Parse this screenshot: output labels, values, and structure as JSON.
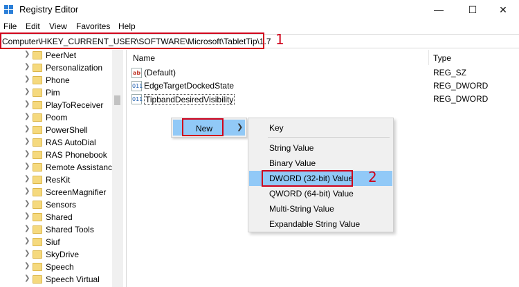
{
  "window": {
    "title": "Registry Editor",
    "controls": [
      "—",
      "☐",
      "✕"
    ]
  },
  "menubar": [
    "File",
    "Edit",
    "View",
    "Favorites",
    "Help"
  ],
  "address": {
    "path": "Computer\\HKEY_CURRENT_USER\\SOFTWARE\\Microsoft\\TabletTip\\1.7",
    "step": "1"
  },
  "tree": {
    "items": [
      "PeerNet",
      "Personalization",
      "Phone",
      "Pim",
      "PlayToReceiver",
      "Poom",
      "PowerShell",
      "RAS AutoDial",
      "RAS Phonebook",
      "Remote Assistance",
      "ResKit",
      "ScreenMagnifier",
      "Sensors",
      "Shared",
      "Shared Tools",
      "Siuf",
      "SkyDrive",
      "Speech",
      "Speech Virtual"
    ]
  },
  "list": {
    "col_name": "Name",
    "col_type": "Type",
    "values": [
      {
        "icon": "ab",
        "name": "(Default)",
        "type": "REG_SZ"
      },
      {
        "icon": "011",
        "name": "EdgeTargetDockedState",
        "type": "REG_DWORD"
      },
      {
        "icon": "011",
        "name": "TipbandDesiredVisibility",
        "type": "REG_DWORD"
      }
    ]
  },
  "context_menu": {
    "new_label": "New",
    "submenu": [
      "Key",
      "String Value",
      "Binary Value",
      "DWORD (32-bit) Value",
      "QWORD (64-bit) Value",
      "Multi-String Value",
      "Expandable String Value"
    ],
    "step": "2"
  },
  "colors": {
    "highlight": "#91c9f7",
    "annotation": "#d0021b"
  }
}
